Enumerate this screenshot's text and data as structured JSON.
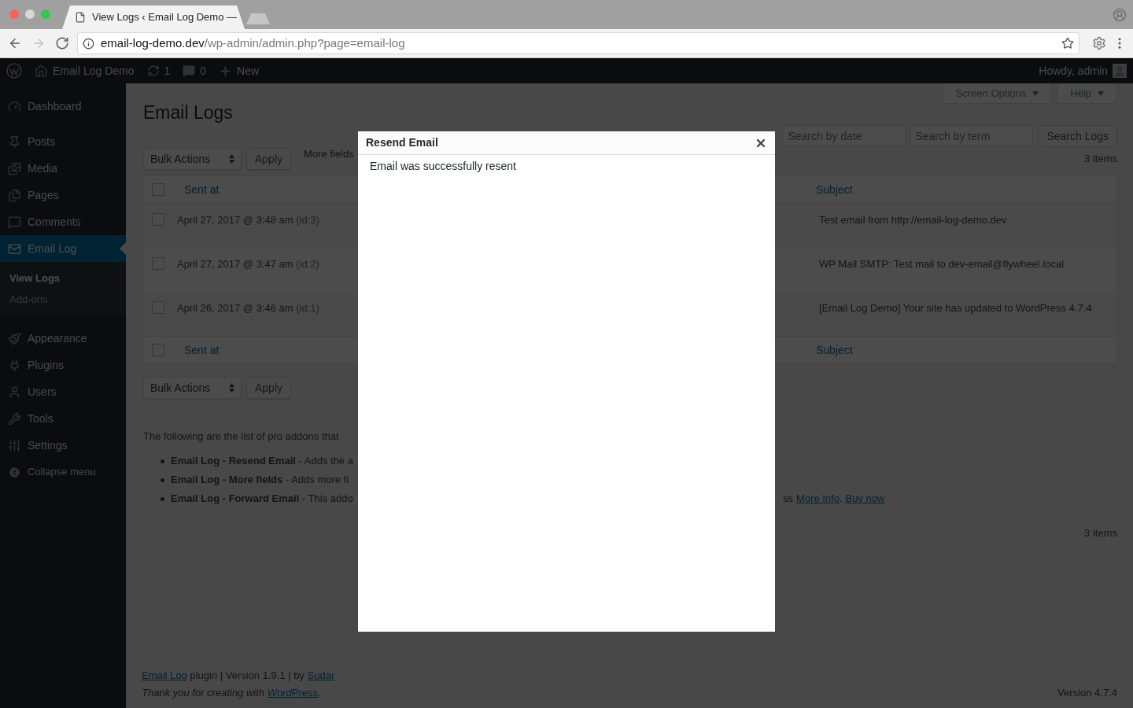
{
  "browser": {
    "tab": {
      "title": "View Logs ‹ Email Log Demo —"
    },
    "nav": [
      {
        "kind": "back",
        "disabled": false
      },
      {
        "kind": "forward",
        "disabled": true
      },
      {
        "kind": "reload",
        "disabled": false
      }
    ],
    "address": {
      "host": "email-log-demo.dev",
      "path": "/wp-admin/admin.php?page=email-log"
    }
  },
  "admin_bar": {
    "site": "Email Log Demo",
    "updates": "1",
    "comments": "0",
    "new": "New",
    "greeting": "Howdy, admin"
  },
  "sidebar": {
    "items": [
      {
        "label": "Dashboard",
        "selected": false
      },
      {
        "label": "Posts",
        "selected": false
      },
      {
        "label": "Media",
        "selected": false
      },
      {
        "label": "Pages",
        "selected": false
      },
      {
        "label": "Comments",
        "selected": false
      },
      {
        "label": "Email Log",
        "selected": true,
        "children": [
          {
            "label": "View Logs",
            "selected": true
          },
          {
            "label": "Add-ons",
            "selected": false
          }
        ]
      },
      {
        "label": "Appearance",
        "selected": false
      },
      {
        "label": "Plugins",
        "selected": false
      },
      {
        "label": "Users",
        "selected": false
      },
      {
        "label": "Tools",
        "selected": false
      },
      {
        "label": "Settings",
        "selected": false
      }
    ],
    "collapse": "Collapse menu"
  },
  "page": {
    "title": "Email Logs",
    "screen_options": "Screen Options",
    "help": "Help",
    "search": {
      "date_placeholder": "Search by date",
      "term_placeholder": "Search by term",
      "button": "Search Logs"
    },
    "top_nav": {
      "bulk": "Bulk Actions",
      "apply": "Apply",
      "more_fields": "More fields",
      "count": "3 items"
    },
    "table": {
      "columns": [
        {
          "label": "Sent at"
        },
        {
          "label": "Subject"
        }
      ],
      "select_all_checked": false,
      "rows": [
        {
          "sent_at": "April 27, 2017 @ 3:48 am",
          "id": "(id:3)",
          "subject": "Test email from http://email-log-demo.dev",
          "checked": false
        },
        {
          "sent_at": "April 27, 2017 @ 3:47 am",
          "id": "(id:2)",
          "subject": "WP Mail SMTP: Test mail to dev-email@flywheel.local",
          "checked": false
        },
        {
          "sent_at": "April 26, 2017 @ 3:46 am",
          "id": "(id:1)",
          "subject": "[Email Log Demo] Your site has updated to WordPress 4.7.4",
          "checked": false
        }
      ],
      "footer_columns": [
        {
          "label": "Sent at"
        },
        {
          "label": "Subject"
        }
      ],
      "footer_checked": false
    },
    "bottom_nav": {
      "bulk": "Bulk Actions",
      "apply": "Apply"
    },
    "addons": {
      "intro": "The following are the list of pro addons that",
      "items": [
        {
          "name": "Email Log - Resend Email",
          "desc": " - Adds the a"
        },
        {
          "name": "Email Log - More fields",
          "desc": " - Adds more fi"
        },
        {
          "name": "Email Log - Forward Email",
          "desc": " - This addo",
          "tail": "ss",
          "links": [
            "More Info",
            "Buy now"
          ],
          "separator": "."
        }
      ]
    },
    "count": "3 items"
  },
  "footer": {
    "plugin_link": "Email Log",
    "credit": " plugin | Version 1.9.1 | by ",
    "author_link": "Sudar",
    "thanks": "Thank you for creating with ",
    "wp_link": "WordPress",
    "end": ".",
    "version": "Version 4.7.4"
  },
  "modal": {
    "title": "Resend Email",
    "message": "Email was successfully resent"
  }
}
